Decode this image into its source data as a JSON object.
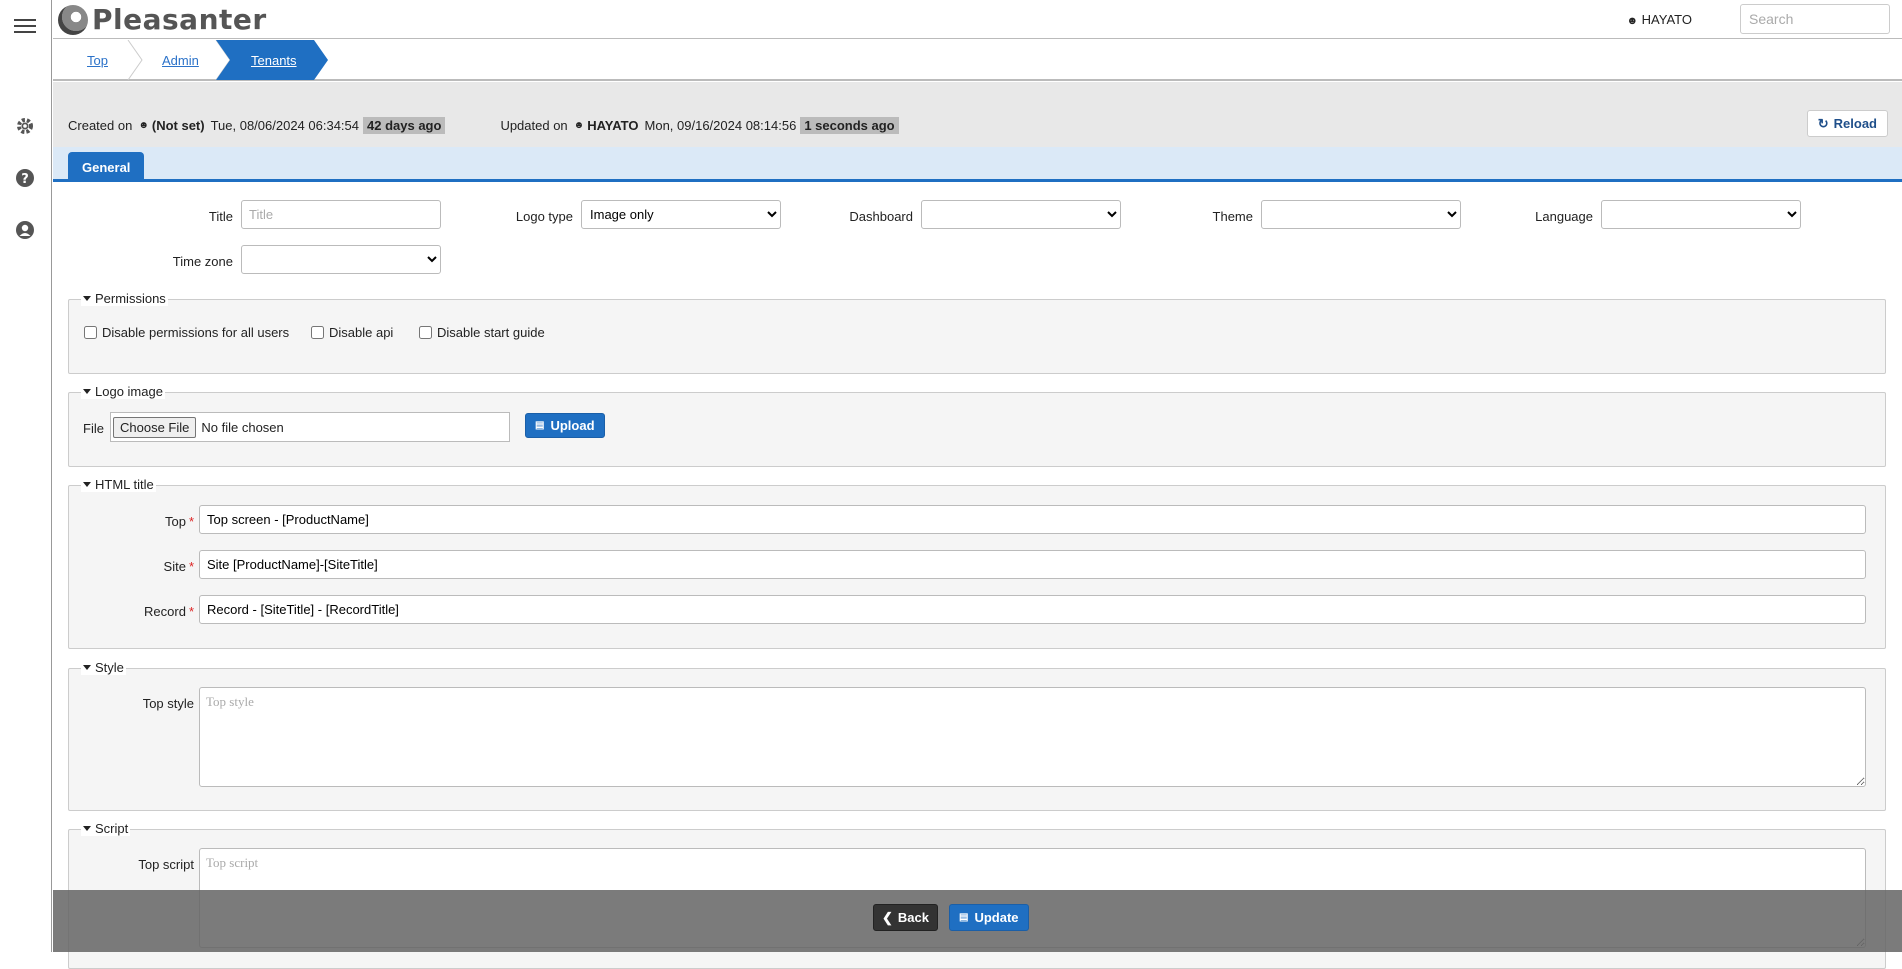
{
  "app": {
    "name": "Pleasanter"
  },
  "header": {
    "user": "HAYATO",
    "search_placeholder": "Search"
  },
  "breadcrumb": {
    "items": [
      "Top",
      "Admin",
      "Tenants"
    ]
  },
  "meta": {
    "created_label": "Created on",
    "created_by": "(Not set)",
    "created_at": "Tue, 08/06/2024 06:34:54",
    "created_ago": "42 days ago",
    "updated_label": "Updated on",
    "updated_by": "HAYATO",
    "updated_at": "Mon, 09/16/2024 08:14:56",
    "updated_ago": "1 seconds ago"
  },
  "reload_label": "Reload",
  "tabs": {
    "general": "General"
  },
  "fields": {
    "title_label": "Title",
    "title_placeholder": "Title",
    "logo_type_label": "Logo type",
    "logo_type_value": "Image only",
    "dashboard_label": "Dashboard",
    "theme_label": "Theme",
    "language_label": "Language",
    "timezone_label": "Time zone"
  },
  "permissions": {
    "legend": "Permissions",
    "disable_permissions": "Disable permissions for all users",
    "disable_api": "Disable api",
    "disable_start_guide": "Disable start guide"
  },
  "logo_image": {
    "legend": "Logo image",
    "file_label": "File",
    "choose_file": "Choose File",
    "no_file": "No file chosen",
    "upload": "Upload"
  },
  "html_title": {
    "legend": "HTML title",
    "top_label": "Top",
    "top_value": "Top screen - [ProductName]",
    "site_label": "Site",
    "site_value": "Site [ProductName]-[SiteTitle]",
    "record_label": "Record",
    "record_value": "Record - [SiteTitle] - [RecordTitle]"
  },
  "style": {
    "legend": "Style",
    "top_style_label": "Top style",
    "top_style_placeholder": "Top style"
  },
  "script": {
    "legend": "Script",
    "top_script_label": "Top script",
    "top_script_placeholder": "Top script"
  },
  "footer": {
    "back": "Back",
    "update": "Update"
  },
  "colors": {
    "accent": "#1f6fc2",
    "tab_bar": "#dbe9f7",
    "footer_overlay": "#646464"
  }
}
